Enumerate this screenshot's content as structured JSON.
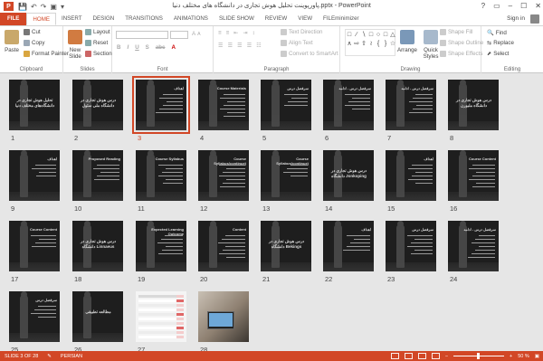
{
  "window": {
    "title": "پاورپوینت تحلیل هوش تجاری در دانشگاه های مختلف دنیا.pptx - PowerPoint",
    "app_icon": "P",
    "controls": [
      "?",
      "▭",
      "–",
      "☐",
      "✕"
    ]
  },
  "quick_access": [
    "save-icon",
    "undo-icon",
    "redo-icon",
    "slideshow-icon",
    "customize-icon"
  ],
  "tabs": [
    "FILE",
    "HOME",
    "INSERT",
    "DESIGN",
    "TRANSITIONS",
    "ANIMATIONS",
    "SLIDE SHOW",
    "REVIEW",
    "VIEW",
    "FILEminimizer"
  ],
  "active_tab": "HOME",
  "signin": "Sign in",
  "ribbon": {
    "clipboard": {
      "label": "Clipboard",
      "paste": "Paste",
      "cut": "Cut",
      "copy": "Copy",
      "format_painter": "Format Painter"
    },
    "slides": {
      "label": "Slides",
      "new_slide": "New",
      "new_slide2": "Slide",
      "layout": "Layout",
      "reset": "Reset",
      "section": "Section"
    },
    "font": {
      "label": "Font"
    },
    "paragraph": {
      "label": "Paragraph",
      "text_direction": "Text Direction",
      "align_text": "Align Text",
      "convert_smartart": "Convert to SmartArt"
    },
    "drawing": {
      "label": "Drawing",
      "arrange": "Arrange",
      "quick_styles": "Quick",
      "quick_styles2": "Styles",
      "shape_fill": "Shape Fill",
      "shape_outline": "Shape Outline",
      "shape_effects": "Shape Effects"
    },
    "editing": {
      "label": "Editing",
      "find": "Find",
      "replace": "Replace",
      "select": "Select"
    }
  },
  "slides": [
    {
      "n": "1",
      "title": "تحلیل هوش تجاری در دانشگاه‌های مختلف دنیا",
      "kind": "center"
    },
    {
      "n": "2",
      "title": "درس هوش تجاری در دانشگاه ملی سئول",
      "kind": "center"
    },
    {
      "n": "3",
      "title": "اهداف",
      "kind": "text",
      "selected": true
    },
    {
      "n": "4",
      "title": "Course Materials",
      "kind": "text"
    },
    {
      "n": "5",
      "title": "سرفصل درس",
      "kind": "text"
    },
    {
      "n": "6",
      "title": "سرفصل درس - ادامه",
      "kind": "text"
    },
    {
      "n": "7",
      "title": "سرفصل درس - ادامه",
      "kind": "text"
    },
    {
      "n": "8",
      "title": "درس هوش تجاری در دانشگاه ملبورن",
      "kind": "center"
    },
    {
      "n": "9",
      "title": "اهداف",
      "kind": "text"
    },
    {
      "n": "10",
      "title": "Proposed Reading",
      "kind": "text"
    },
    {
      "n": "11",
      "title": "Course Syllabus",
      "kind": "text"
    },
    {
      "n": "12",
      "title": "Course Syllabus(continue)",
      "kind": "text"
    },
    {
      "n": "13",
      "title": "Course Syllabus(continue)",
      "kind": "text"
    },
    {
      "n": "14",
      "title": "درس هوش تجاری در دانشگاه Jonkoping",
      "kind": "center"
    },
    {
      "n": "15",
      "title": "اهداف",
      "kind": "text"
    },
    {
      "n": "16",
      "title": "Course Content",
      "kind": "text"
    },
    {
      "n": "17",
      "title": "Course Content",
      "kind": "text"
    },
    {
      "n": "18",
      "title": "درس هوش تجاری در دانشگاه Linnaeus",
      "kind": "center"
    },
    {
      "n": "19",
      "title": "Expected Learning Outcome",
      "kind": "text"
    },
    {
      "n": "20",
      "title": "Content",
      "kind": "text"
    },
    {
      "n": "21",
      "title": "درس هوش تجاری در دانشگاه Bekings",
      "kind": "center"
    },
    {
      "n": "22",
      "title": "اهداف",
      "kind": "text"
    },
    {
      "n": "23",
      "title": "سرفصل درس",
      "kind": "text"
    },
    {
      "n": "24",
      "title": "سرفصل درس - ادامه",
      "kind": "text"
    },
    {
      "n": "25",
      "title": "سرفصل درس",
      "kind": "text"
    },
    {
      "n": "26",
      "title": "مطالعه تطبیقی",
      "kind": "center"
    },
    {
      "n": "27",
      "title": "",
      "kind": "table"
    },
    {
      "n": "28",
      "title": "",
      "kind": "photo"
    }
  ],
  "status": {
    "slide_info": "SLIDE 3 OF 28",
    "language": "PERSIAN",
    "zoom": "50 %"
  },
  "colors": {
    "accent": "#d24726",
    "canvas": "#e6e6e6",
    "slide_bg": "#1e1e1e"
  }
}
